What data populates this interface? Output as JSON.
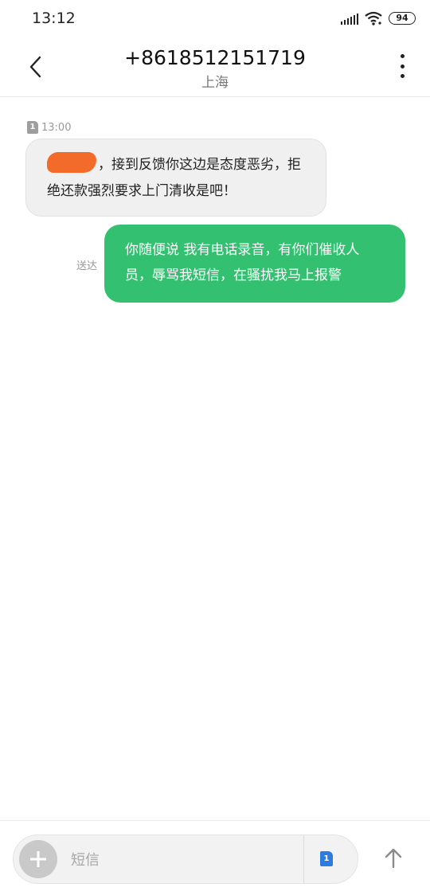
{
  "status_bar": {
    "time": "13:12",
    "battery": "94",
    "icons": [
      "signal-icon",
      "wifi-icon",
      "battery-icon"
    ]
  },
  "header": {
    "title": "+8618512151719",
    "subtitle": "上海",
    "back_icon": "chevron-left-icon",
    "more_icon": "more-vertical-icon"
  },
  "messages": [
    {
      "direction": "incoming",
      "sim": "1",
      "time": "13:00",
      "line1": "，接到反馈你这边是态度恶劣，拒",
      "line2": "绝还款强烈要求上门清收是吧！"
    },
    {
      "direction": "outgoing",
      "status": "送达",
      "line1": "你随便说 我有电话录音，有你们催收人",
      "line2": "员，辱骂我短信，在骚扰我马上报警"
    }
  ],
  "composer": {
    "placeholder": "短信",
    "sim": "1",
    "add_icon": "plus-icon",
    "send_icon": "arrow-up-icon"
  },
  "colors": {
    "outgoing_bubble": "#33c171",
    "incoming_bubble": "#f0f0f0",
    "sim_accent": "#2b7be0",
    "redaction": "#f26b2a"
  }
}
